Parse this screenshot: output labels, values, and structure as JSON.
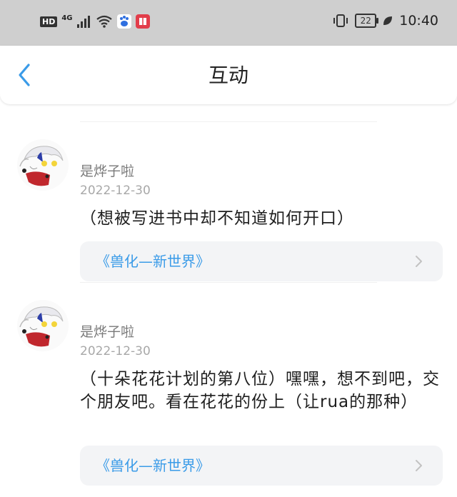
{
  "status_bar": {
    "hd": "HD",
    "network": "4G",
    "battery_level": "22",
    "time": "10:40"
  },
  "header": {
    "title": "互动"
  },
  "posts": [
    {
      "username": "是烨子啦",
      "date": "2022-12-30",
      "content": "（想被写进书中却不知道如何开口）",
      "book": "《兽化—新世界》"
    },
    {
      "username": "是烨子啦",
      "date": "2022-12-30",
      "content": "（十朵花花计划的第八位）嘿嘿，想不到吧，交个朋友吧。看在花花的份上（让rua的那种）",
      "book": "《兽化—新世界》"
    }
  ],
  "colors": {
    "accent": "#3a9be8",
    "status_bar_bg": "#cfcfcf"
  }
}
